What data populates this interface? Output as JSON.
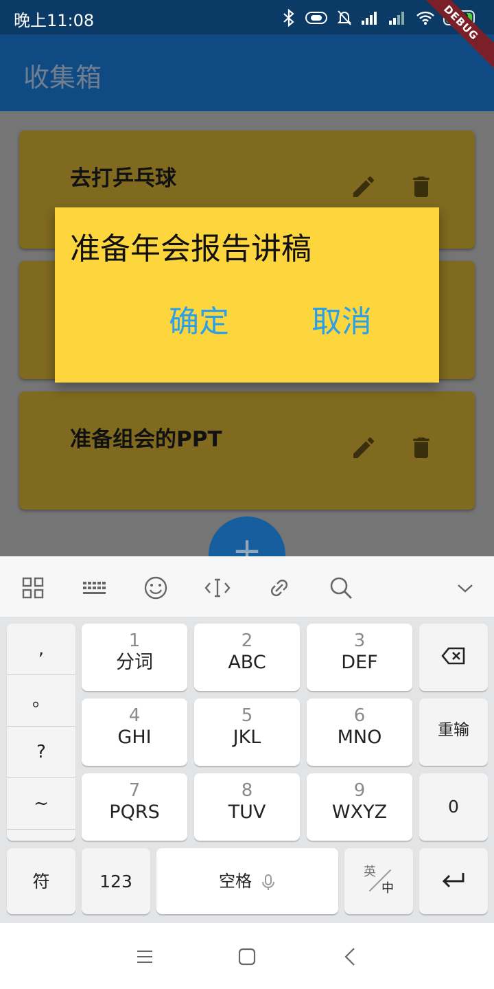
{
  "status_bar": {
    "time": "晚上11:08",
    "battery": "100",
    "debug_banner": "DEBUG"
  },
  "app_bar": {
    "title": "收集箱"
  },
  "cards": [
    {
      "title": "去打乒乓球"
    },
    {
      "title": ""
    },
    {
      "title": "准备组会的PPT"
    }
  ],
  "fab": {
    "label": "+"
  },
  "dialog": {
    "title": "准备年会报告讲稿",
    "confirm_label": "确定",
    "cancel_label": "取消"
  },
  "keyboard": {
    "toolbar_icons": [
      "grid-icon",
      "keyboard-icon",
      "emoji-icon",
      "cursor-icon",
      "link-icon",
      "search-icon",
      "chevron-down-icon"
    ],
    "punctuation": [
      ",",
      "。",
      "?",
      "~"
    ],
    "keys": [
      {
        "num": "1",
        "label": "分词"
      },
      {
        "num": "2",
        "label": "ABC"
      },
      {
        "num": "3",
        "label": "DEF"
      },
      {
        "num": "4",
        "label": "GHI"
      },
      {
        "num": "5",
        "label": "JKL"
      },
      {
        "num": "6",
        "label": "MNO"
      },
      {
        "num": "7",
        "label": "PQRS"
      },
      {
        "num": "8",
        "label": "TUV"
      },
      {
        "num": "9",
        "label": "WXYZ"
      }
    ],
    "reenter_label": "重输",
    "zero_label": "0",
    "symbol_label": "符",
    "numbers_label": "123",
    "space_label": "空格",
    "lang_en": "英",
    "lang_zh": "中"
  },
  "colors": {
    "app_bar": "#104a82",
    "dialog": "#fdd53d",
    "dialog_buttons": "#2aa0e8",
    "card": "#7f6a1f",
    "fab": "#165e9e"
  }
}
